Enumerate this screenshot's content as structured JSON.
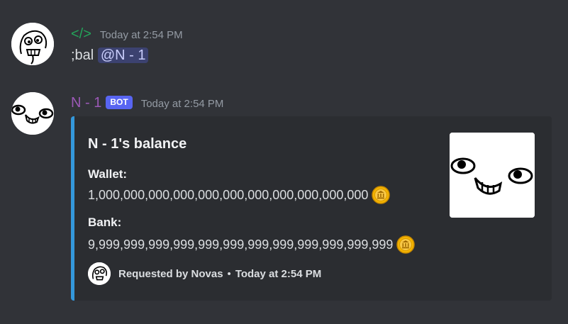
{
  "messages": [
    {
      "username": "</>",
      "username_color": "#23a55a",
      "timestamp": "Today at 2:54 PM",
      "content_prefix": ";bal ",
      "mention": "@N - 1",
      "avatar_icon": "doodle-face-avatar-icon"
    },
    {
      "username": "N - 1",
      "username_color": "#9b59b6",
      "bot_tag": "BOT",
      "timestamp": "Today at 2:54 PM",
      "avatar_icon": "googly-eyes-face-avatar-icon"
    }
  ],
  "embed": {
    "accent_color": "#3498db",
    "title": "N - 1's balance",
    "fields": [
      {
        "name": "Wallet:",
        "value": "1,000,000,000,000,000,000,000,000,000,000,000",
        "icon": "coin-icon"
      },
      {
        "name": "Bank:",
        "value": "9,999,999,999,999,999,999,999,999,999,999,999,999",
        "icon": "coin-icon"
      }
    ],
    "thumbnail_icon": "googly-eyes-face-thumbnail",
    "footer": {
      "text": "Requested by Novas",
      "separator": "•",
      "timestamp": "Today at 2:54 PM",
      "icon": "doodle-face-footer-avatar-icon"
    }
  }
}
